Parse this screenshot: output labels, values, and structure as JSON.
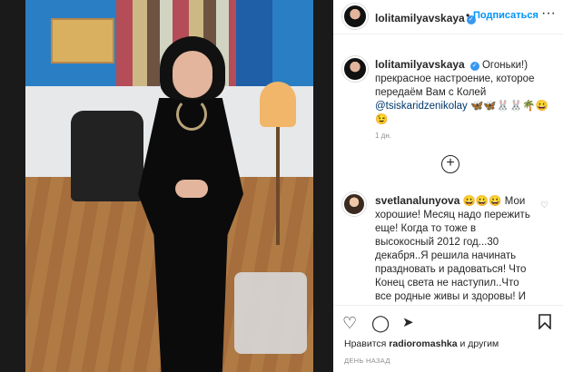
{
  "post": {
    "username": "lolitamilyavskaya",
    "follow_label": "Подписаться",
    "dot_separator": "•",
    "more_label": "···",
    "caption_text": "Огоньки!) прекрасное настроение, которое передаём Вам с Колей",
    "caption_mention": "@tsiskaridzenikolay",
    "caption_emoji": "🦋🦋🐰🐰🌴😀😉",
    "caption_time": "1 дн.",
    "load_more_label": "+"
  },
  "comment": {
    "username": "svetlanalunyova",
    "text": "😀😀😀 Мои хорошие! Месяц надо пережить еще! Когда то тоже в высокосный 2012 год...30 декабря..Я решила начинать праздновать и радоваться! Что Конец света не наступил..Что все родные живы и здоровы! И решила на каток! Шампанское"
  },
  "actions": {
    "like_icon": "♡",
    "comment_icon": "◯",
    "share_icon": "➤",
    "save_icon": "🔖"
  },
  "likes": {
    "prefix": "Нравится",
    "user": "radioromashka",
    "suffix": "и другим"
  },
  "post_date": "ДЕНЬ НАЗАД",
  "colors": {
    "accent": "#0095f6",
    "verified": "#3897f0"
  }
}
